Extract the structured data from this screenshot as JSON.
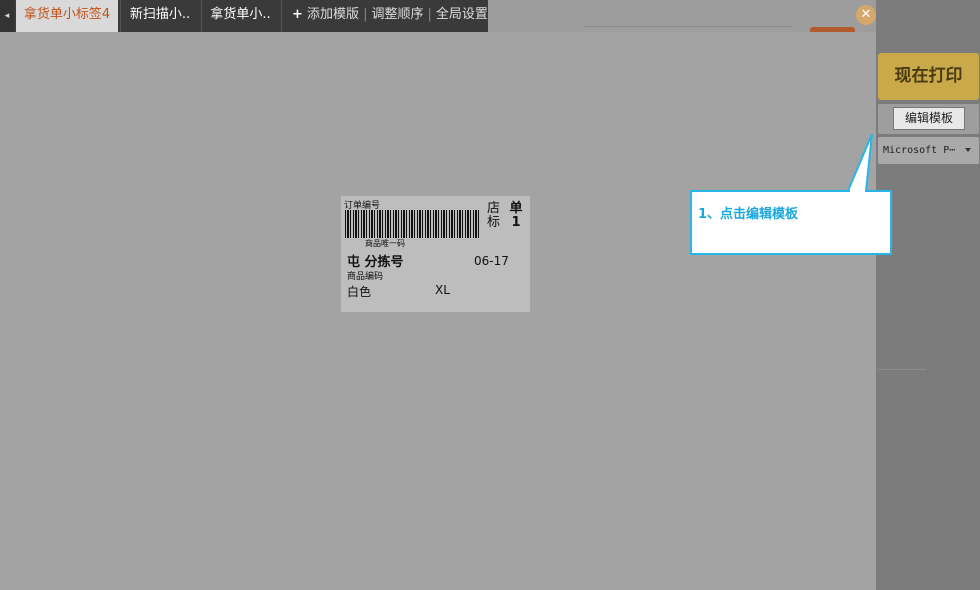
{
  "tabs": {
    "scroll_arrow": "◂",
    "items": [
      {
        "label": "拿货单小标签4"
      },
      {
        "label": "新扫描小.."
      },
      {
        "label": "拿货单小.."
      }
    ],
    "add_template": "添加模版",
    "reorder": "调整顺序",
    "global_settings": "全局设置"
  },
  "label_preview": {
    "order_no_label": "订单编号",
    "unique_code_label": "商品唯一码",
    "shop_label": "店标",
    "single_label": "单1",
    "sort_no_label": "屯  分拣号",
    "date": "06-17",
    "product_code_label": "商品编码",
    "color": "白色",
    "size": "XL"
  },
  "right_panel": {
    "print_now": "现在打印",
    "edit_template": "编辑模板",
    "printer": "Microsoft P⋯"
  },
  "close_icon": "✕",
  "callout": {
    "text": "1、点击编辑模板",
    "border_color": "#27b6e6",
    "text_color": "#1ba8dd"
  }
}
